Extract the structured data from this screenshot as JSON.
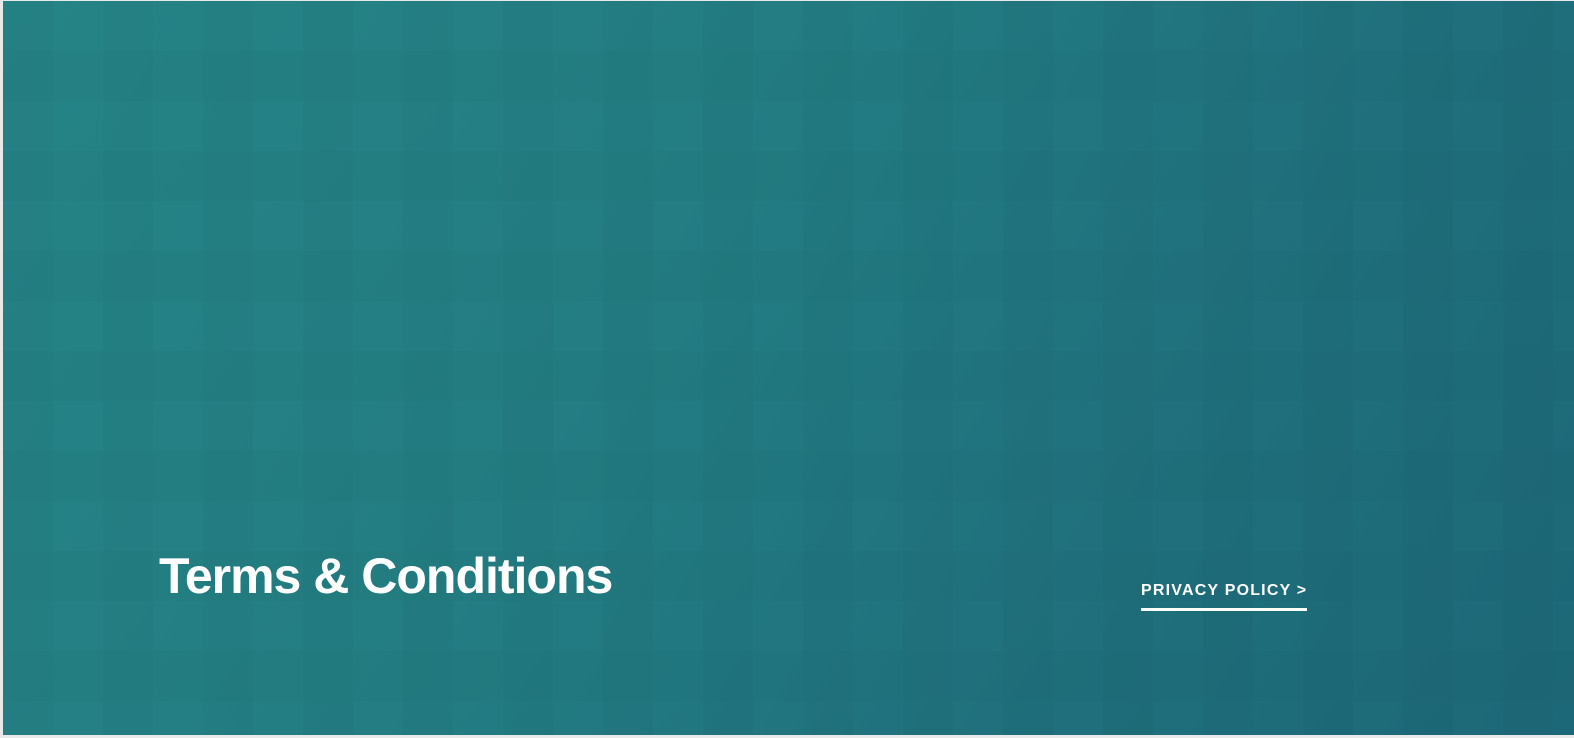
{
  "hero": {
    "title": "Terms & Conditions",
    "background_colors": [
      "#258486",
      "#1d6878"
    ]
  },
  "nav": {
    "privacy_link_label": "PRIVACY POLICY >"
  }
}
